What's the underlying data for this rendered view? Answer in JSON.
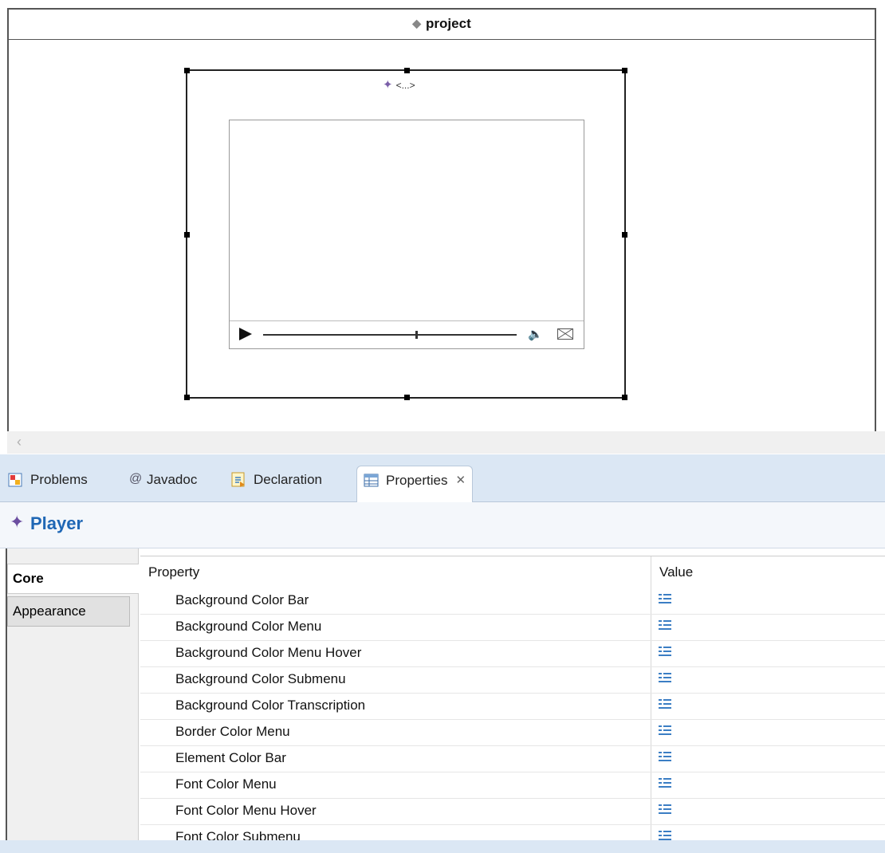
{
  "canvas": {
    "project_title": "project",
    "player_label": "<...>",
    "player": {
      "progress_fraction": 0.6
    }
  },
  "tabs": [
    {
      "label": "Problems",
      "icon": "problems-icon"
    },
    {
      "label": "Javadoc",
      "icon": "at-icon"
    },
    {
      "label": "Declaration",
      "icon": "declaration-icon"
    },
    {
      "label": "Properties",
      "icon": "properties-icon",
      "active": true
    }
  ],
  "properties_panel": {
    "title": "Player",
    "side_tabs": [
      "Core",
      "Appearance"
    ],
    "columns": {
      "property": "Property",
      "value": "Value"
    },
    "rows": [
      "Background Color Bar",
      "Background Color Menu",
      "Background Color Menu Hover",
      "Background Color Submenu",
      "Background Color Transcription",
      "Border Color Menu",
      "Element Color Bar",
      "Font Color Menu",
      "Font Color Menu Hover",
      "Font Color Submenu"
    ]
  },
  "colors": {
    "tabbar": "#dbe7f4",
    "title": "#1f67b5",
    "accent_icon": "#6b4ea0"
  }
}
